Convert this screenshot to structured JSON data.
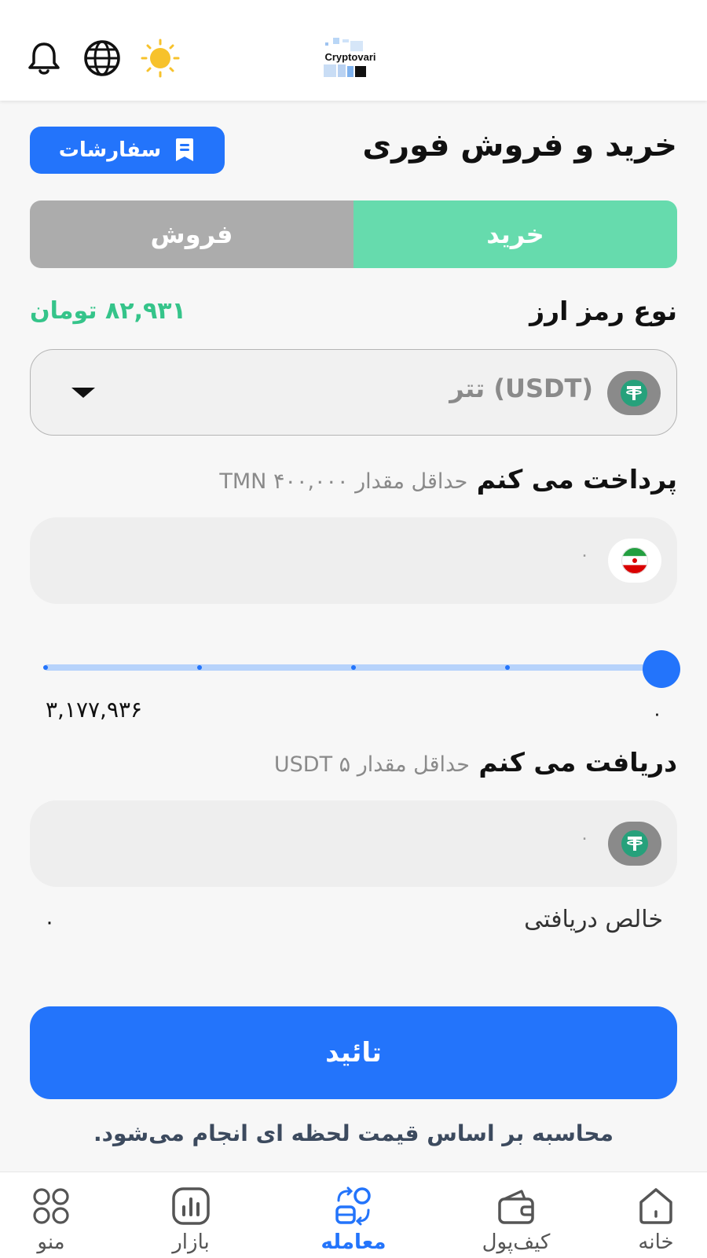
{
  "header": {
    "brand": "Cryptovari",
    "icons": [
      "bell-icon",
      "globe-icon",
      "sun-icon"
    ]
  },
  "page": {
    "title": "خرید و فروش فوری",
    "orders_label": "سفارشات"
  },
  "tabs": {
    "buy": "خرید",
    "sell": "فروش",
    "active": "buy"
  },
  "currency": {
    "label": "نوع رمز ارز",
    "price": "۸۲,۹۳۱ تومان",
    "selected": "تتر (USDT)"
  },
  "pay": {
    "label": "پرداخت می کنم",
    "hint": "حداقل مقدار ۴۰۰,۰۰۰ TMN",
    "value": "۰"
  },
  "slider": {
    "max_label": "۳,۱۷۷,۹۳۶",
    "min_label": "۰",
    "level": 1.0
  },
  "receive": {
    "label": "دریافت می کنم",
    "hint": "حداقل مقدار ۵ USDT",
    "value": "۰"
  },
  "net": {
    "label": "خالص دریافتی",
    "value": "۰"
  },
  "confirm_label": "تائید",
  "note": "محاسبه بر اساس قیمت لحظه ای انجام می‌شود.",
  "nav": {
    "home": "خانه",
    "wallet": "کیف‌پول",
    "trade": "معامله",
    "market": "بازار",
    "menu": "منو",
    "active": "trade"
  },
  "colors": {
    "primary": "#2374fb",
    "buy": "#66dbad",
    "sell": "#acacac",
    "price": "#35c48a",
    "tether": "#26a17b"
  }
}
